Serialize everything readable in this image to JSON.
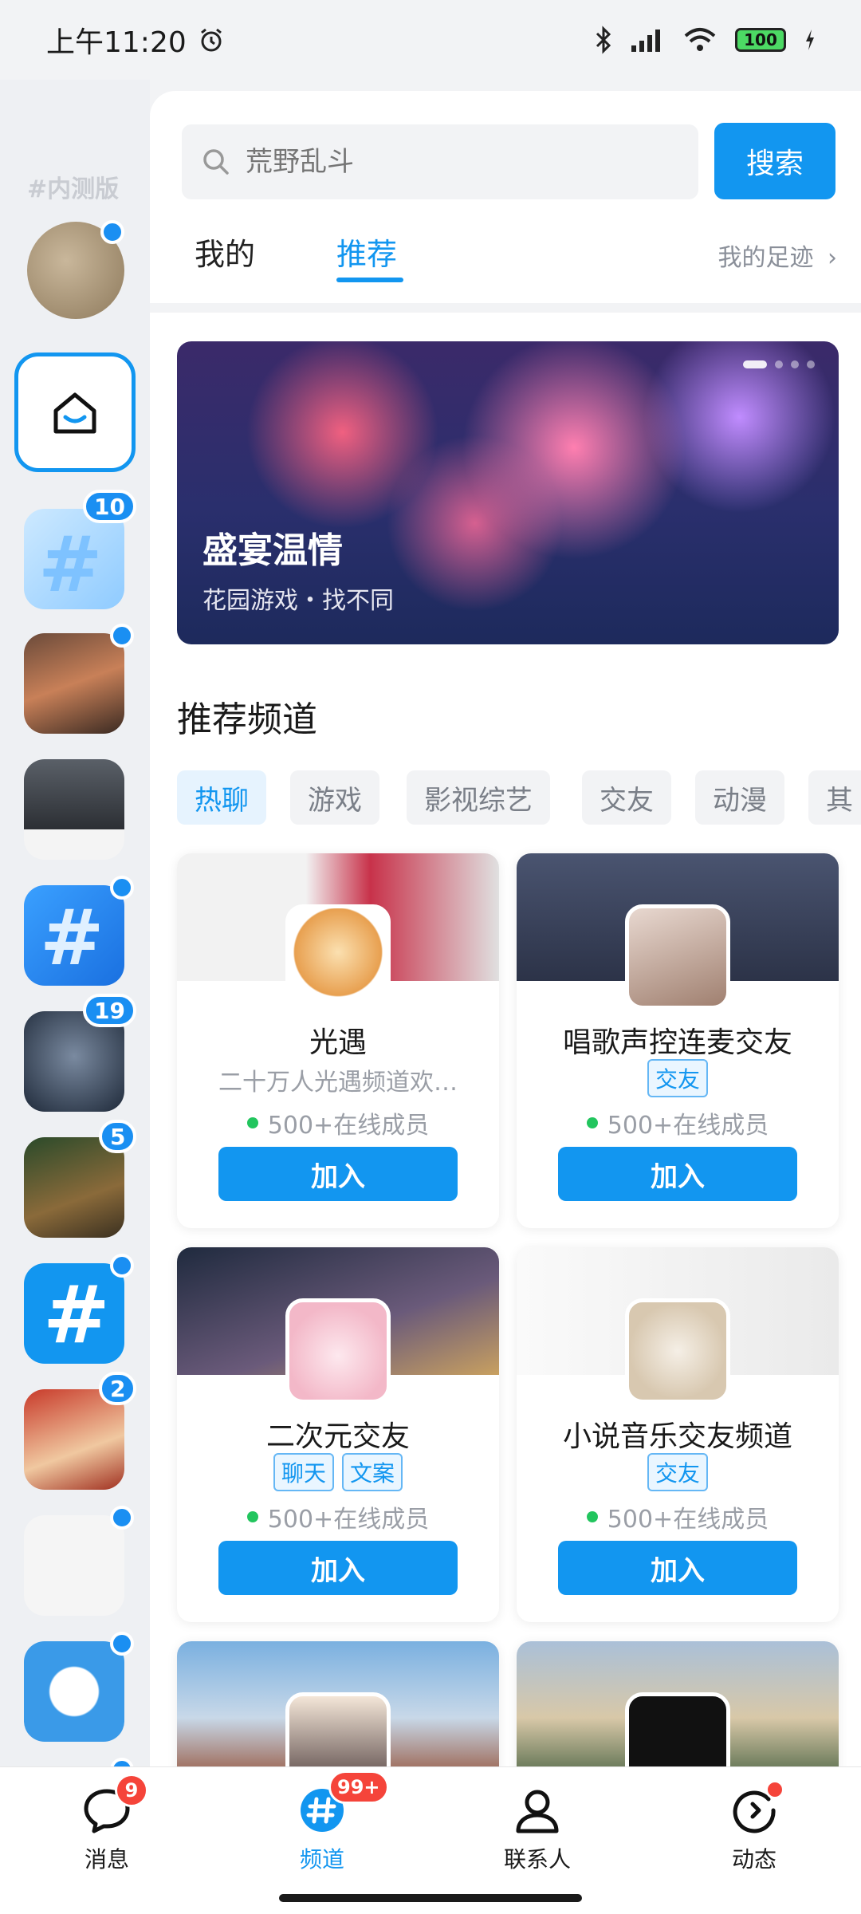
{
  "status_bar": {
    "time": "上午11:20",
    "battery": "100"
  },
  "rail": {
    "label": "#内测版",
    "badges": [
      "10",
      "19",
      "5",
      "2"
    ]
  },
  "search": {
    "placeholder": "荒野乱斗",
    "button": "搜索"
  },
  "tabs": {
    "mine": "我的",
    "recommend": "推荐",
    "footprint": "我的足迹"
  },
  "banner": {
    "title": "盛宴温情",
    "subtitle": "花园游戏・找不同"
  },
  "section_title": "推荐频道",
  "categories": [
    "热聊",
    "游戏",
    "影视综艺",
    "交友",
    "动漫",
    "其"
  ],
  "cards": [
    {
      "name": "光遇",
      "desc": "二十万人光遇频道欢…",
      "tags": [],
      "online": "500+在线成员",
      "join": "加入"
    },
    {
      "name": "唱歌声控连麦交友",
      "desc": "",
      "tags": [
        "交友"
      ],
      "online": "500+在线成员",
      "join": "加入"
    },
    {
      "name": "二次元交友",
      "desc": "",
      "tags": [
        "聊天",
        "文案"
      ],
      "online": "500+在线成员",
      "join": "加入"
    },
    {
      "name": "小说音乐交友频道",
      "desc": "",
      "tags": [
        "交友"
      ],
      "online": "500+在线成员",
      "join": "加入"
    }
  ],
  "bottom_nav": {
    "messages": {
      "label": "消息",
      "badge": "9"
    },
    "channels": {
      "label": "频道",
      "badge": "99+"
    },
    "contacts": {
      "label": "联系人"
    },
    "moments": {
      "label": "动态"
    }
  },
  "colors": {
    "accent": "#1296f0",
    "badge_red": "#f5443a",
    "online_green": "#22c55e"
  }
}
